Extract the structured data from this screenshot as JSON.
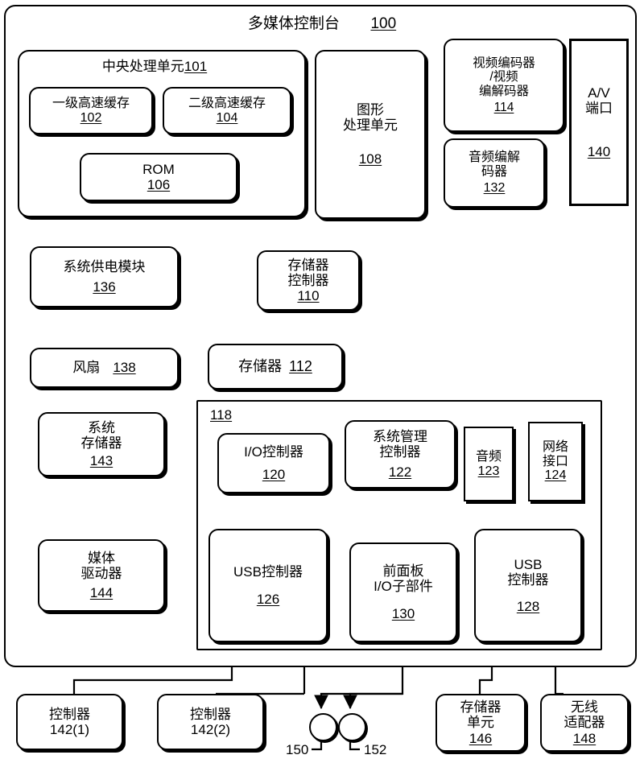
{
  "diagram": {
    "title": "多媒体控制台",
    "title_ref": "100",
    "cpu": {
      "label": "中央处理单元",
      "ref": "101"
    },
    "io_hub_ref": "118",
    "blocks": [
      {
        "id": "l1cache",
        "label": "一级高速缓存",
        "ref": "102"
      },
      {
        "id": "l2cache",
        "label": "二级高速缓存",
        "ref": "104"
      },
      {
        "id": "rom",
        "label": "ROM",
        "ref": "106"
      },
      {
        "id": "gpu",
        "label": "图形\n处理单元",
        "ref": "108"
      },
      {
        "id": "video-codec",
        "label": "视频编码器\n/视频\n编解码器",
        "ref": "114"
      },
      {
        "id": "av-port",
        "label": "A/V\n端口",
        "ref": "140"
      },
      {
        "id": "audio-codec",
        "label": "音频编解\n码器",
        "ref": "132"
      },
      {
        "id": "psu",
        "label": "系统供电模块",
        "ref": "136"
      },
      {
        "id": "fan",
        "label": "风扇",
        "ref": "138"
      },
      {
        "id": "mem-ctrl",
        "label": "存储器\n控制器",
        "ref": "110"
      },
      {
        "id": "memory",
        "label": "存储器",
        "ref": "112"
      },
      {
        "id": "sys-memory",
        "label": "系统\n存储器",
        "ref": "143"
      },
      {
        "id": "media-drive",
        "label": "媒体\n驱动器",
        "ref": "144"
      },
      {
        "id": "io-ctrl",
        "label": "I/O控制器",
        "ref": "120"
      },
      {
        "id": "sys-mgmt",
        "label": "系统管理\n控制器",
        "ref": "122"
      },
      {
        "id": "audio",
        "label": "音频",
        "ref": "123"
      },
      {
        "id": "net-iface",
        "label": "网络\n接口",
        "ref": "124"
      },
      {
        "id": "usb-ctrl-1",
        "label": "USB控制器",
        "ref": "126"
      },
      {
        "id": "front-panel",
        "label": "前面板\nI/O子部件",
        "ref": "130"
      },
      {
        "id": "usb-ctrl-2",
        "label": "USB\n控制器",
        "ref": "128"
      },
      {
        "id": "controller-1",
        "label": "控制器",
        "ref": "142(1)"
      },
      {
        "id": "controller-2",
        "label": "控制器",
        "ref": "142(2)"
      },
      {
        "id": "mem-unit",
        "label": "存储器\n单元",
        "ref": "146"
      },
      {
        "id": "wireless",
        "label": "无线\n适配器",
        "ref": "148"
      }
    ],
    "markers": [
      {
        "id": "marker-150",
        "ref": "150"
      },
      {
        "id": "marker-152",
        "ref": "152"
      }
    ],
    "colors": {
      "line": "#000000",
      "background": "#ffffff"
    }
  }
}
